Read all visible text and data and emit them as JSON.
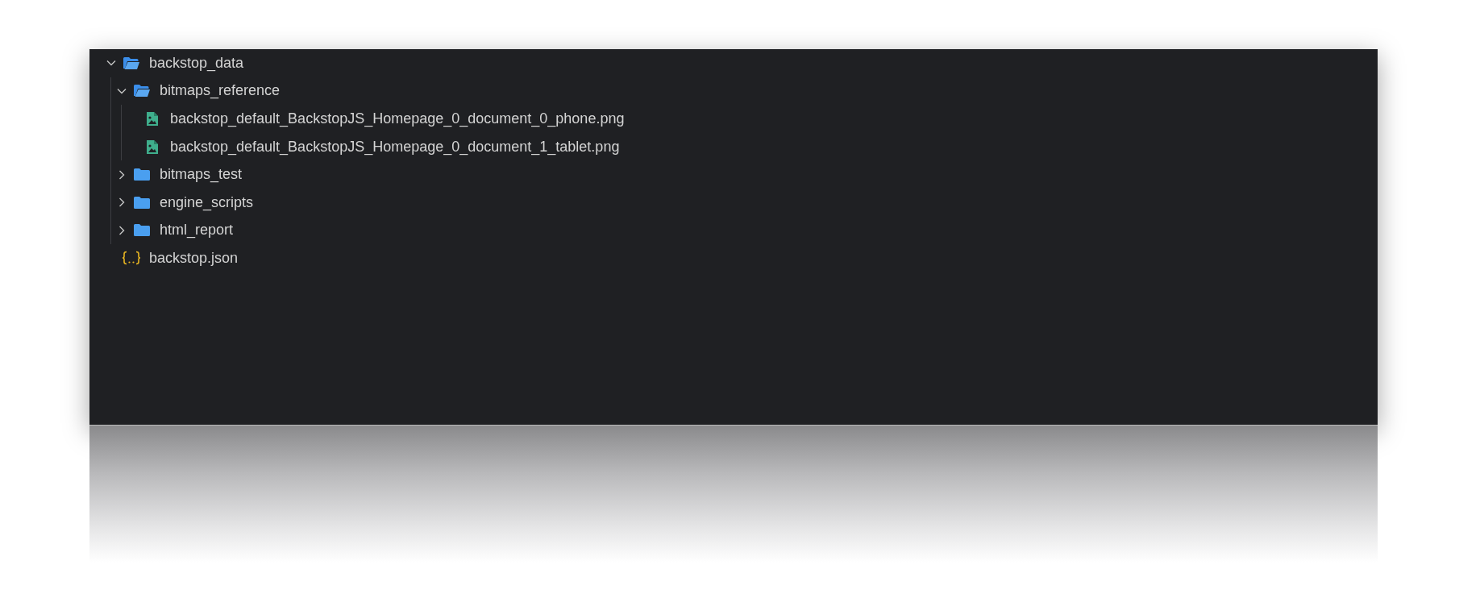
{
  "explorer": {
    "items": [
      {
        "kind": "folder",
        "name": "backstop_data",
        "expanded": true,
        "children": [
          {
            "kind": "folder",
            "name": "bitmaps_reference",
            "expanded": true,
            "children": [
              {
                "kind": "image",
                "name": "backstop_default_BackstopJS_Homepage_0_document_0_phone.png"
              },
              {
                "kind": "image",
                "name": "backstop_default_BackstopJS_Homepage_0_document_1_tablet.png"
              }
            ]
          },
          {
            "kind": "folder",
            "name": "bitmaps_test",
            "expanded": false
          },
          {
            "kind": "folder",
            "name": "engine_scripts",
            "expanded": false
          },
          {
            "kind": "folder",
            "name": "html_report",
            "expanded": false
          }
        ]
      },
      {
        "kind": "json",
        "name": "backstop.json"
      }
    ]
  }
}
